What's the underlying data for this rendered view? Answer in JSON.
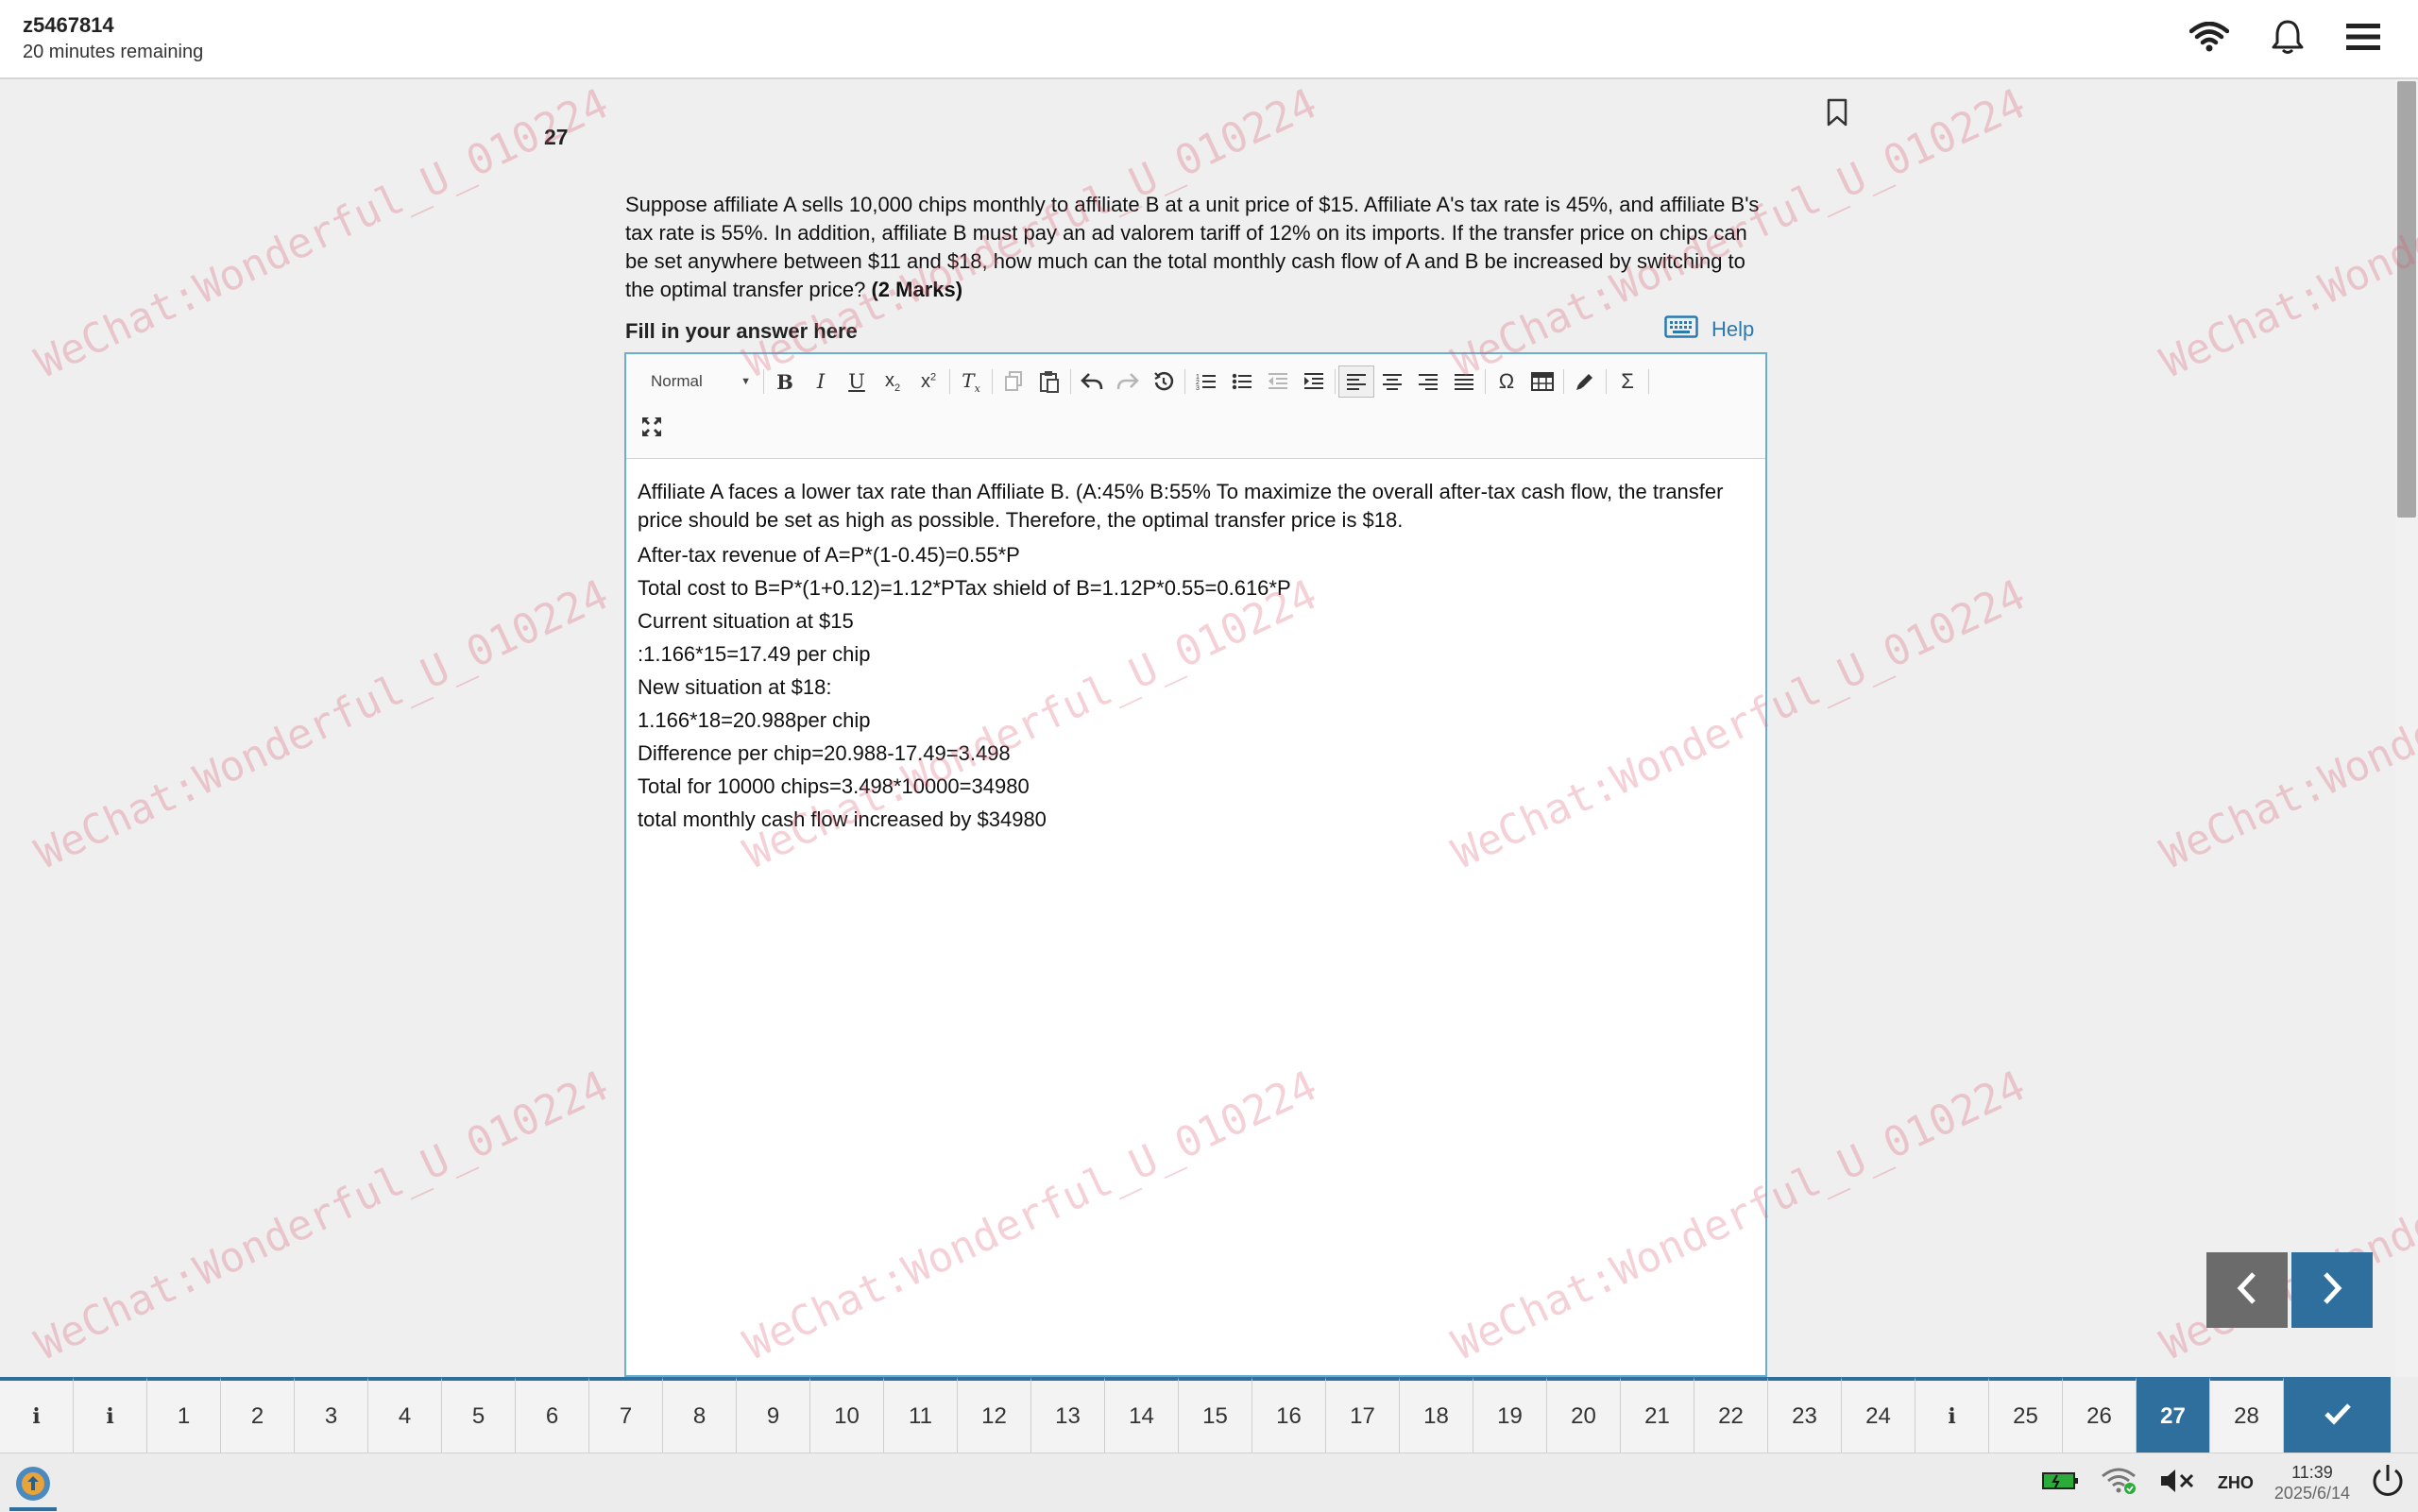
{
  "header": {
    "user_id": "z5467814",
    "time_remaining": "20 minutes remaining"
  },
  "question": {
    "number": "27",
    "text": "Suppose affiliate A sells 10,000 chips monthly to affiliate B at a unit price of $15. Affiliate A's tax rate is 45%, and affiliate B's tax rate is 55%. In addition, affiliate B must pay an ad valorem tariff of 12% on its imports. If the transfer price on chips can be set anywhere between $11 and $18, how much can the total monthly cash flow of A and B be increased by switching to the optimal transfer price?",
    "marks": "(2 Marks)"
  },
  "answer_area": {
    "label": "Fill in your answer here",
    "help_label": "Help"
  },
  "editor": {
    "format_select": "Normal",
    "toolbar_icons": [
      "bold-icon",
      "italic-icon",
      "underline-icon",
      "subscript-icon",
      "superscript-icon",
      "clear-format-icon",
      "copy-icon",
      "paste-icon",
      "undo-icon",
      "redo-icon",
      "history-icon",
      "numbered-list-icon",
      "bulleted-list-icon",
      "outdent-icon",
      "indent-icon",
      "align-left-icon",
      "align-center-icon",
      "align-right-icon",
      "align-justify-icon",
      "special-char-icon",
      "table-icon",
      "pencil-icon",
      "sigma-icon",
      "fullscreen-icon"
    ],
    "paragraph": "Affiliate A faces a lower tax rate than Affiliate B. (A:45% B:55% To maximize the overall after-tax cash flow, the transfer price should be set as high as possible. Therefore, the optimal transfer price is $18.",
    "lines": [
      "After-tax revenue of A=P*(1-0.45)=0.55*P",
      "Total cost to B=P*(1+0.12)=1.12*PTax shield of B=1.12P*0.55=0.616*P",
      "Current situation at $15",
      ":1.166*15=17.49 per chip",
      "New situation at $18:",
      "1.166*18=20.988per chip",
      "Difference per chip=20.988-17.49=3.498",
      "Total for 10000 chips=3.498*10000=34980",
      "total monthly cash flow increased by $34980"
    ]
  },
  "watermark": "WeChat:Wonderful_U_010224",
  "question_nav": {
    "items": [
      "i",
      "i",
      "1",
      "2",
      "3",
      "4",
      "5",
      "6",
      "7",
      "8",
      "9",
      "10",
      "11",
      "12",
      "13",
      "14",
      "15",
      "16",
      "17",
      "18",
      "19",
      "20",
      "21",
      "22",
      "23",
      "24",
      "i",
      "25",
      "26",
      "27",
      "28"
    ],
    "current": "27",
    "submit_icon": "checkmark-icon"
  },
  "taskbar": {
    "language": "ZHO",
    "time": "11:39",
    "date": "2025/6/14"
  },
  "colors": {
    "accent": "#2e6f9e",
    "editor_border": "#6aaed0",
    "watermark": "#dc5a6e"
  }
}
